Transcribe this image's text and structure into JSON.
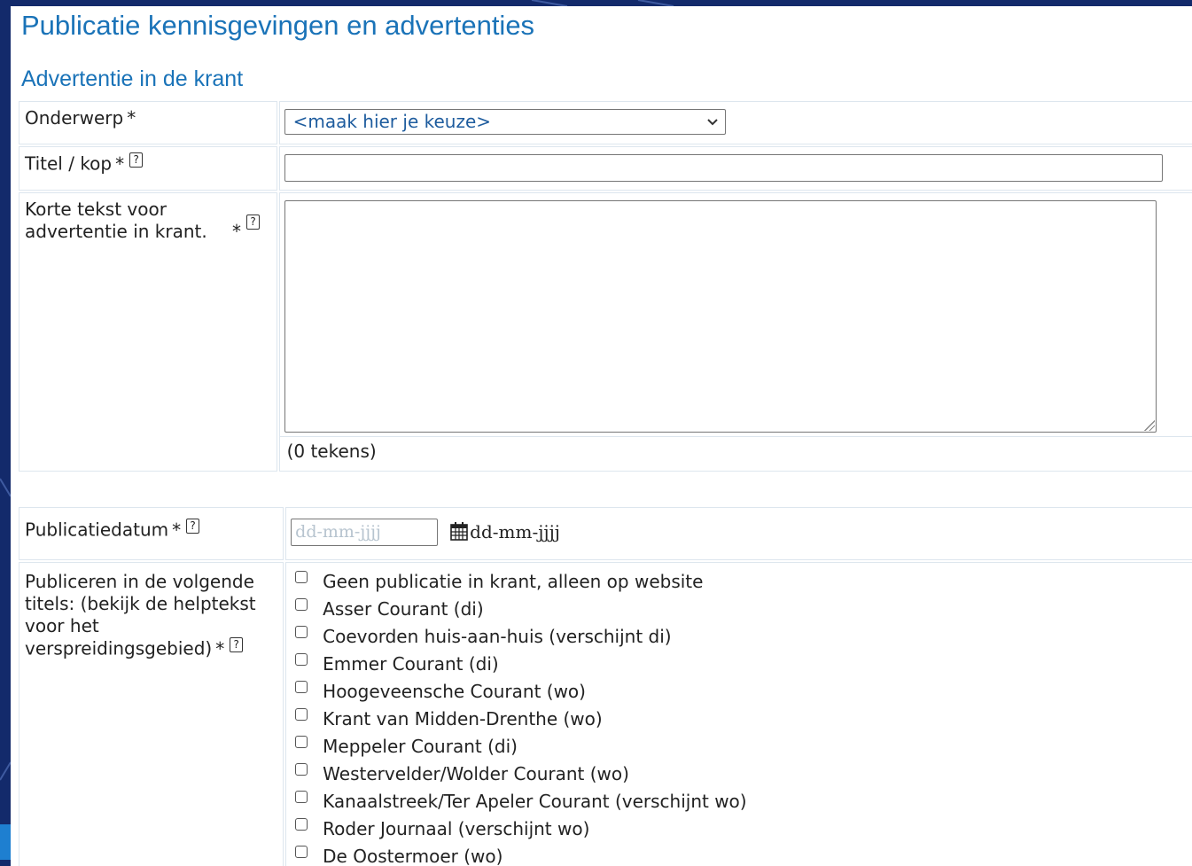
{
  "page": {
    "title": "Publicatie kennisgevingen en advertenties",
    "section": "Advertentie in de krant"
  },
  "form": {
    "onderwerp": {
      "label": "Onderwerp",
      "required": "*",
      "select_value": "<maak hier je keuze>"
    },
    "titel": {
      "label": "Titel / kop",
      "required": "*",
      "help": "?",
      "value": ""
    },
    "korte_tekst": {
      "label": "Korte tekst voor advertentie in krant.",
      "required": "*",
      "help": "?",
      "value": "",
      "counter": "(0 tekens)"
    },
    "publicatiedatum": {
      "label": "Publicatiedatum",
      "required": "*",
      "help": "?",
      "placeholder": "dd-mm-jjjj",
      "format_hint": "dd-mm-jjjj"
    },
    "titels": {
      "label": "Publiceren in de volgende titels: (bekijk de helptekst voor het verspreidingsgebied)",
      "required": "*",
      "help": "?",
      "options": [
        "Geen publicatie in krant, alleen op website",
        "Asser Courant (di)",
        "Coevorden huis-aan-huis (verschijnt di)",
        "Emmer Courant (di)",
        "Hoogeveensche Courant (wo)",
        "Krant van Midden-Drenthe (wo)",
        "Meppeler Courant (di)",
        "Westervelder/Wolder Courant (wo)",
        "Kanaalstreek/Ter Apeler Courant (verschijnt wo)",
        "Roder Journaal (verschijnt wo)",
        "De Oostermoer (wo)"
      ]
    }
  },
  "colors": {
    "heading": "#1a73b8",
    "background": "#132a6b",
    "border": "#dde6ee",
    "select_text": "#1e5c9e"
  },
  "icons": {
    "select": "chevron-down-icon",
    "help": "help-icon",
    "date": "calendar-icon"
  }
}
